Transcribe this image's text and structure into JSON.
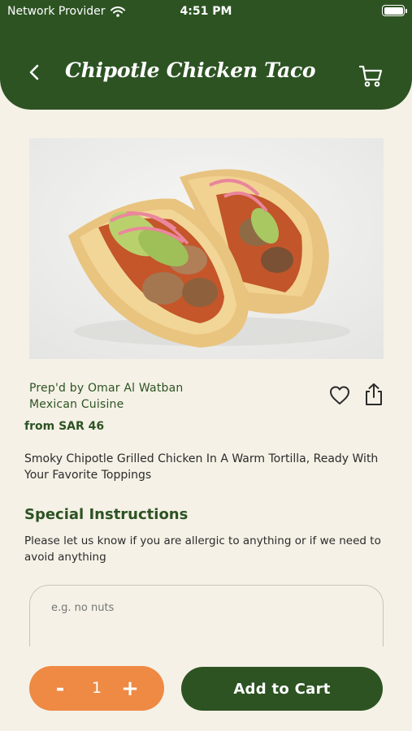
{
  "status_bar": {
    "carrier": "Network Provider",
    "time": "4:51 PM"
  },
  "header": {
    "title": "Chipotle Chicken Taco"
  },
  "product": {
    "chef": "Prep'd by Omar Al Watban",
    "cuisine": "Mexican Cuisine",
    "price": "from SAR 46",
    "description": "Smoky Chipotle Grilled Chicken In A Warm Tortilla, Ready With Your Favorite Toppings"
  },
  "special_instructions": {
    "title": "Special Instructions",
    "text": "Please let us know if you are allergic to anything or if we need to avoid anything",
    "placeholder": "e.g. no nuts",
    "value": ""
  },
  "quantity": {
    "minus": "-",
    "value": "1",
    "plus": "+"
  },
  "actions": {
    "add_to_cart": "Add to Cart"
  },
  "colors": {
    "primary": "#2d5323",
    "accent": "#ee8a43",
    "background": "#f5f1e6"
  },
  "icons": [
    "wifi-icon",
    "battery-icon",
    "back-icon",
    "cart-icon",
    "heart-icon",
    "share-icon"
  ]
}
